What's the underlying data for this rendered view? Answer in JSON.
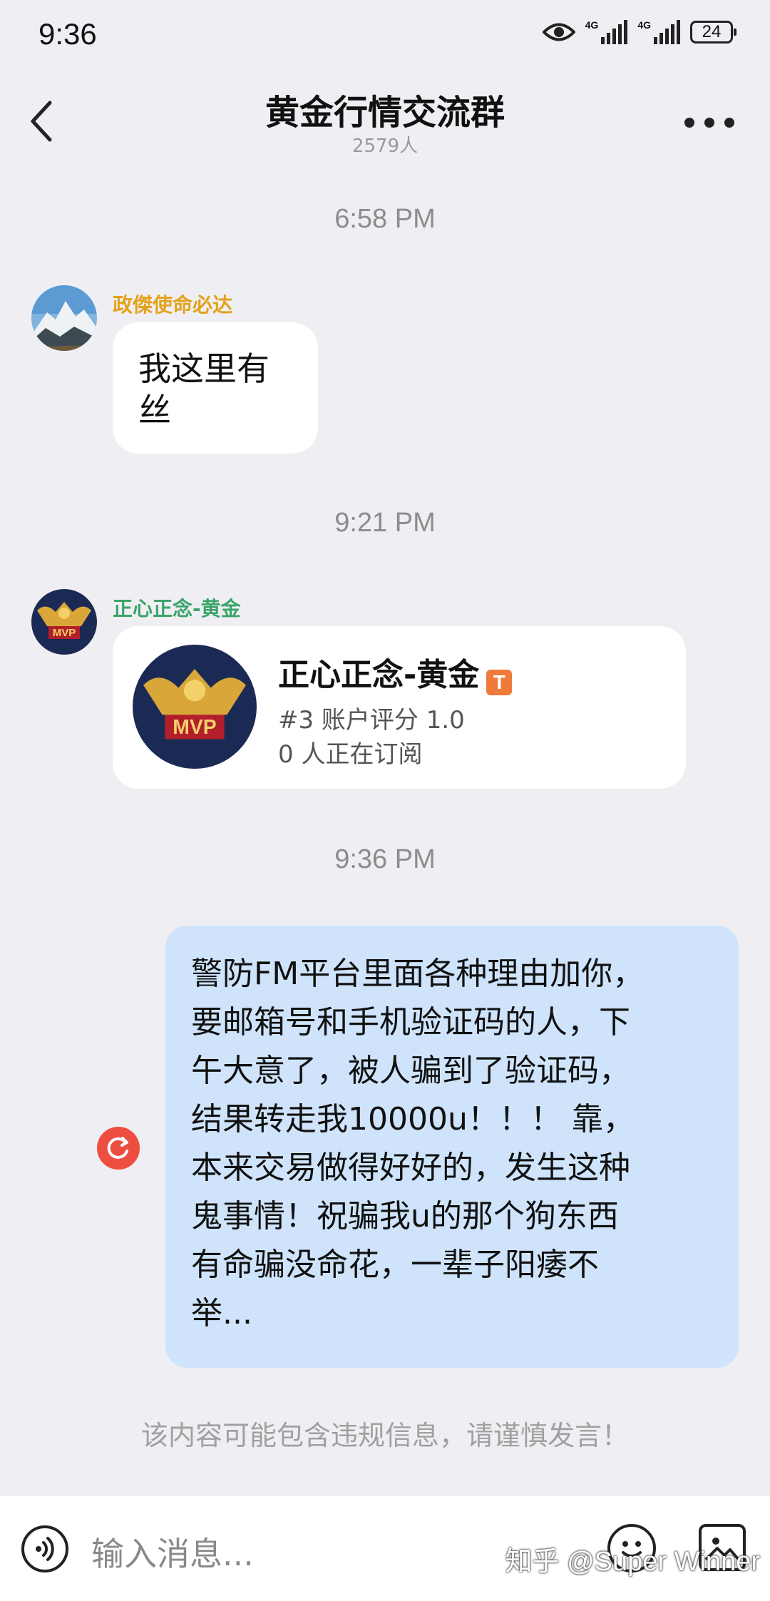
{
  "status_bar": {
    "time": "9:36",
    "network_1": "4G",
    "network_2": "4G",
    "battery": "24",
    "icons": [
      "eye-icon",
      "signal-icon",
      "signal-icon",
      "battery-icon"
    ]
  },
  "header": {
    "title": "黄金行情交流群",
    "member_count": "2579人",
    "back_icon": "chevron-left-icon",
    "more_icon": "more-horizontal-icon"
  },
  "messages": [
    {
      "type": "timestamp",
      "text": "6:58 PM"
    },
    {
      "type": "text",
      "sender": "政傑使命必达",
      "sender_color": "#e3a21a",
      "text_line1": "我这里有",
      "text_line2": "丝"
    },
    {
      "type": "timestamp",
      "text": "9:21 PM"
    },
    {
      "type": "card",
      "sender": "正心正念-黄金",
      "sender_color": "#3aa46a",
      "card": {
        "name": "正心正念-黄金",
        "badge": "T",
        "rank_line": "#3 账户评分 1.0",
        "subscribers_line": "0 人正在订阅"
      }
    },
    {
      "type": "timestamp",
      "text": "9:36 PM"
    },
    {
      "type": "own_text",
      "lines": [
        "警防FM平台里面各种理由加你，",
        "要邮箱号和手机验证码的人，下",
        "午大意了，被人骗到了验证码，",
        "结果转走我10000u！！！ 靠，",
        "本来交易做得好好的，发生这种",
        "鬼事情！祝骗我u的那个狗东西",
        "有命骗没命花，一辈子阳痿不",
        "举..."
      ],
      "status_icon": "retry-icon",
      "status_color": "#ee4e3f"
    }
  ],
  "warning": "该内容可能包含违规信息，请谨慎发言！",
  "input_bar": {
    "placeholder": "输入消息...",
    "voice_icon": "voice-icon",
    "emoji_icon": "emoji-icon",
    "image_icon": "image-icon"
  },
  "watermark": "知乎 @Super Winner",
  "colors": {
    "background": "#efeff3",
    "own_bubble": "#cfe4fb",
    "other_bubble": "#ffffff",
    "badge": "#f07a3a"
  }
}
